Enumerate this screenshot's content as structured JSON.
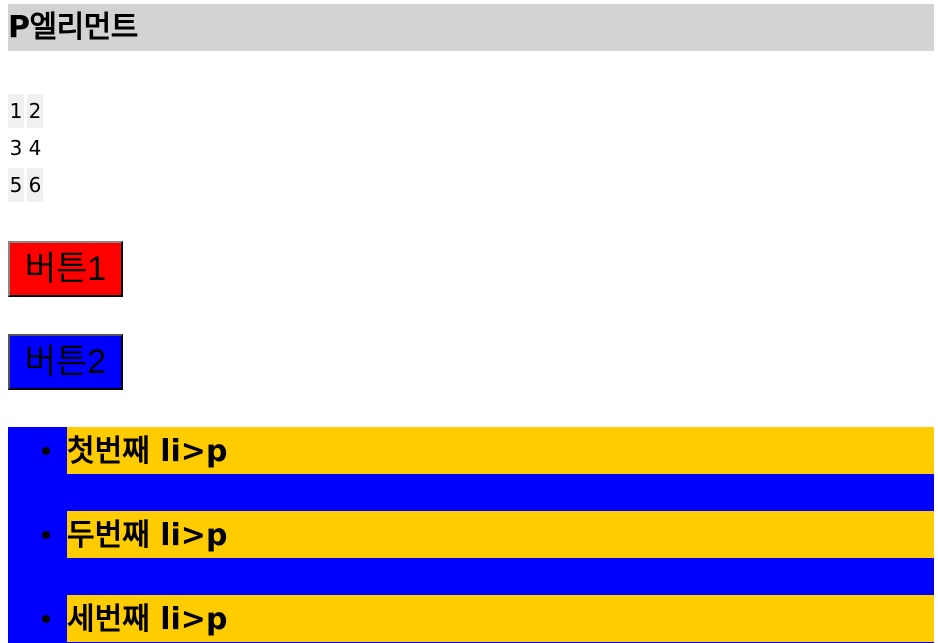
{
  "title": "P엘리먼트",
  "grid": {
    "rows": [
      [
        "1",
        "2"
      ],
      [
        "3",
        "4"
      ],
      [
        "5",
        "6"
      ]
    ]
  },
  "buttons": {
    "button1_label": "버튼1",
    "button2_label": "버튼2"
  },
  "list": {
    "items": [
      "첫번째 li>p",
      "두번째 li>p",
      "세번째 li>p"
    ]
  },
  "colors": {
    "title_bg": "#d3d3d3",
    "button1_bg": "#ff0000",
    "button2_bg": "#0000ff",
    "list_bg": "#0000ff",
    "paragraph_bg": "#ffcc00"
  }
}
